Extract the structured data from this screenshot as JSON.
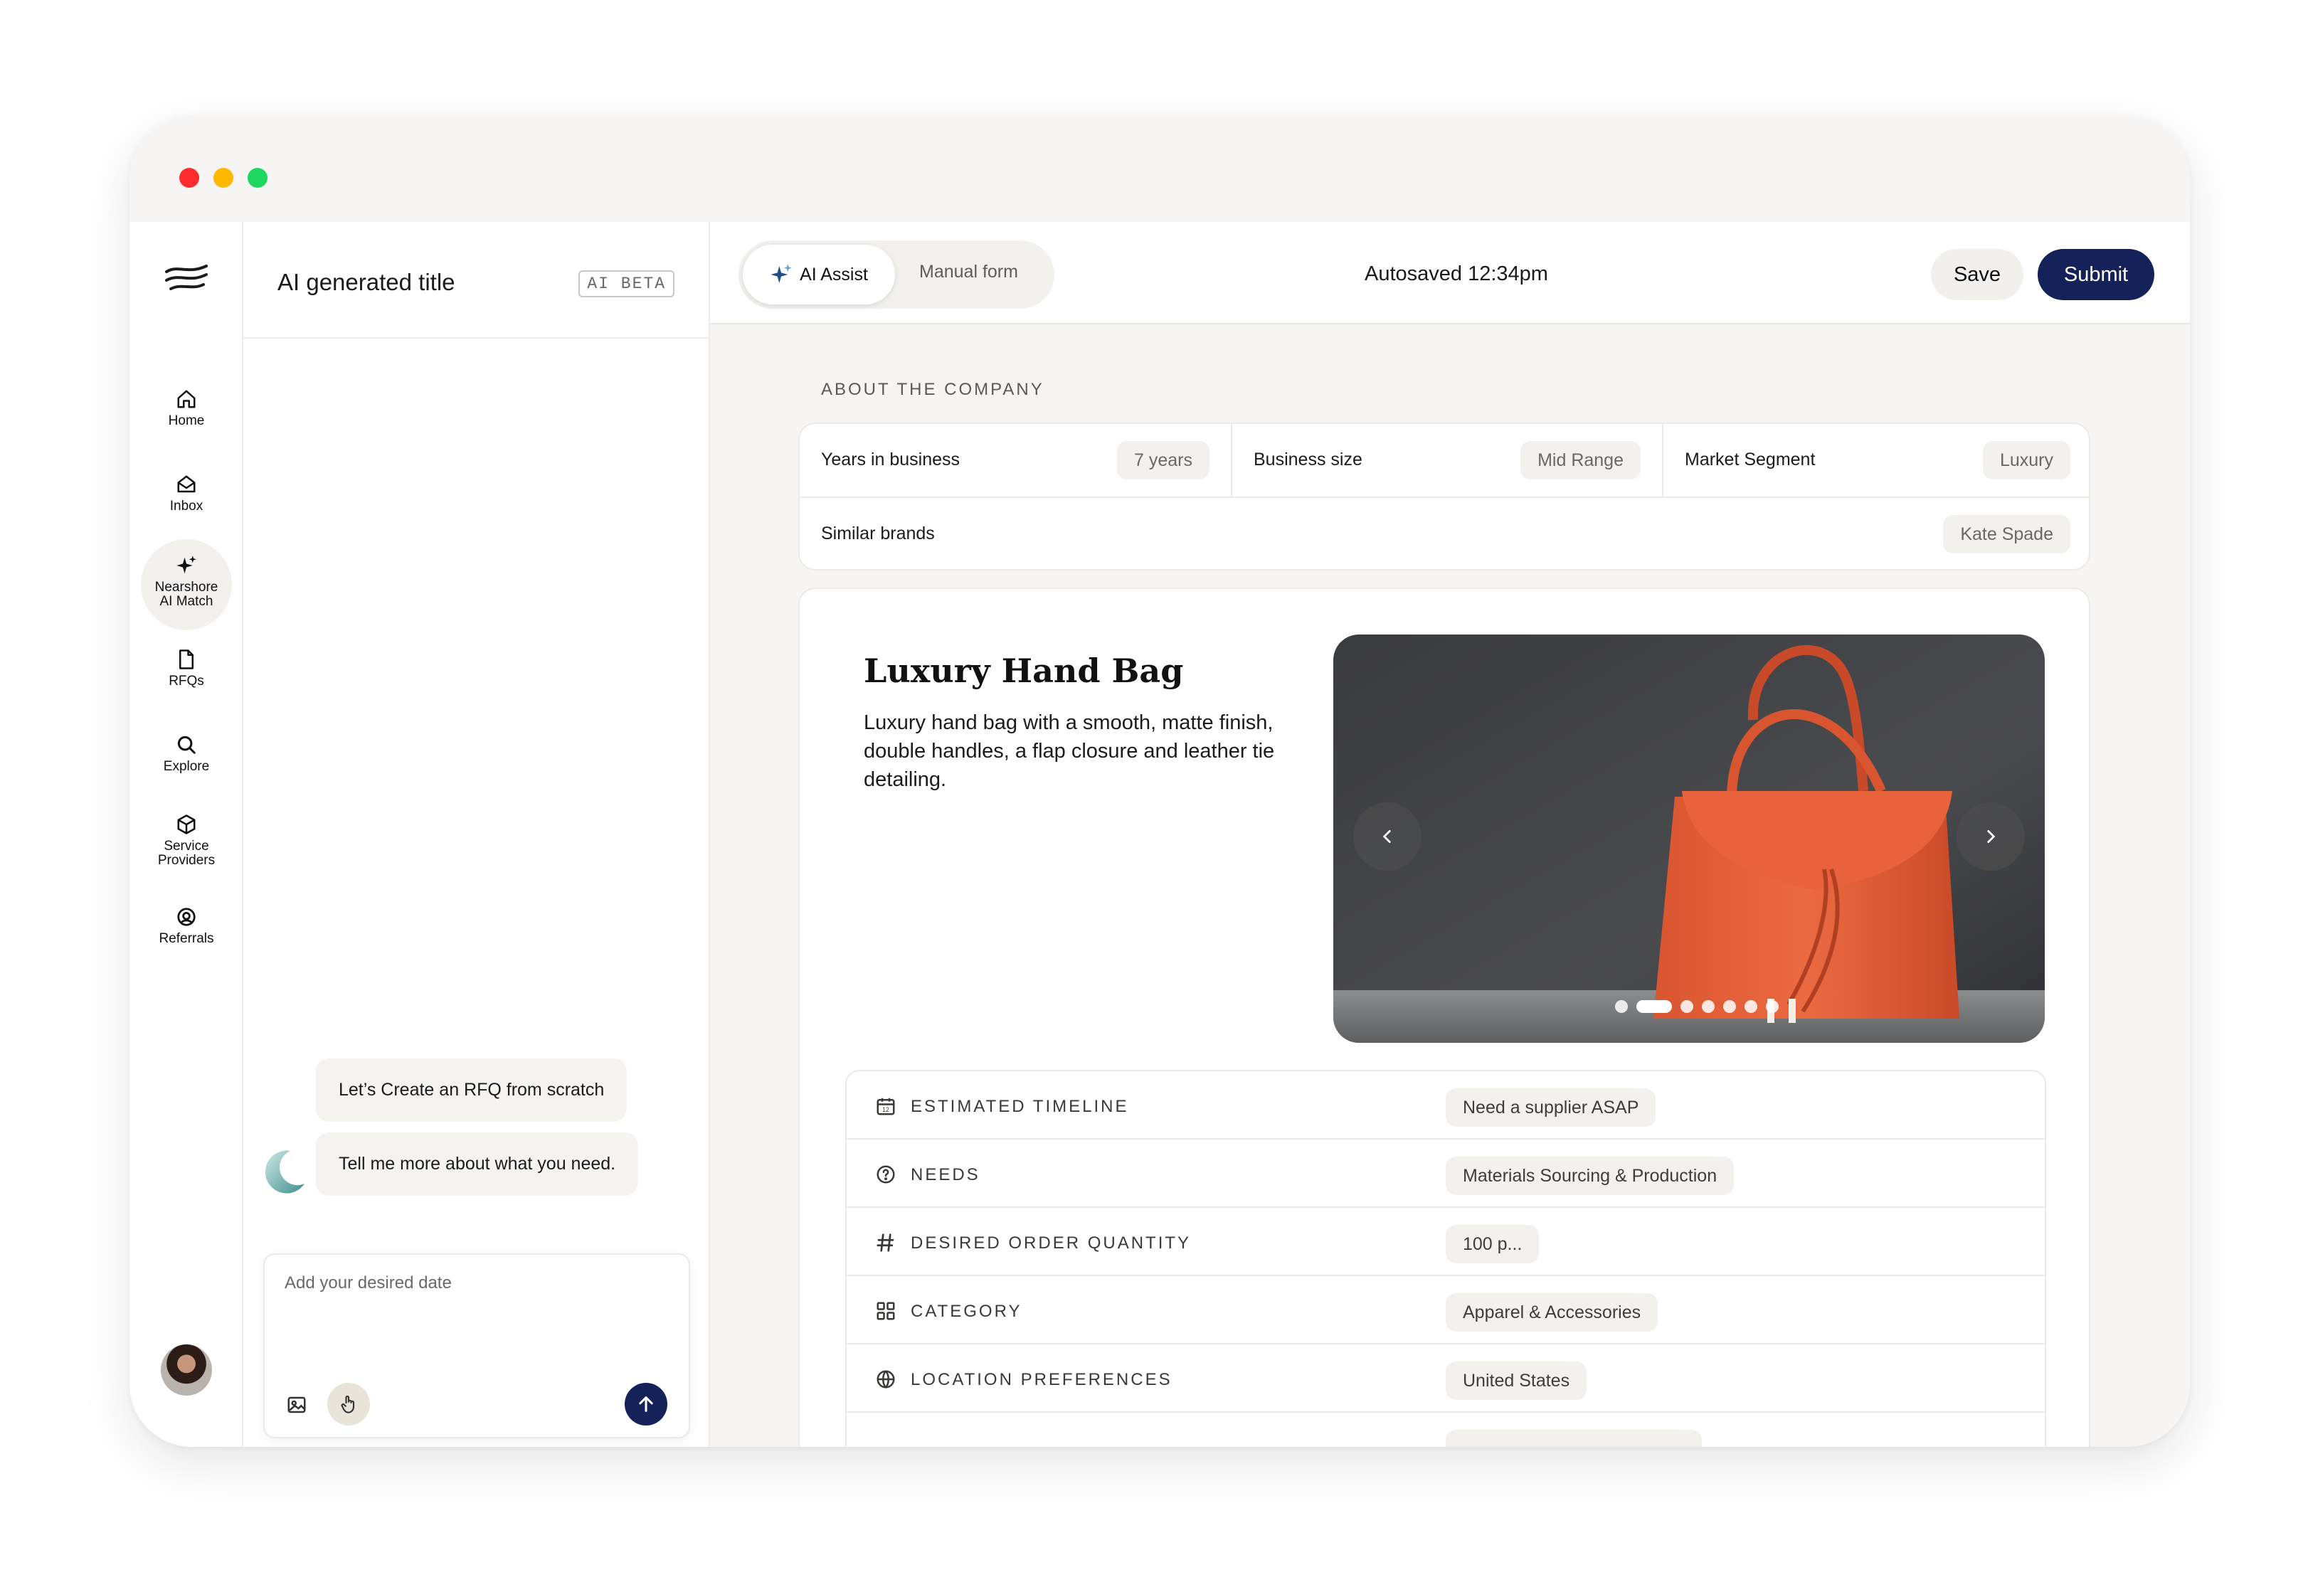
{
  "window": {
    "traffic_lights": {
      "close": "#ff2d2d",
      "minimize": "#ffb800",
      "maximize": "#1ed760"
    }
  },
  "rail": {
    "items": [
      {
        "label": "Home",
        "icon": "home-icon"
      },
      {
        "label": "Inbox",
        "icon": "inbox-icon"
      },
      {
        "label": "Nearshore AI Match",
        "icon": "sparkle-icon",
        "active": true
      },
      {
        "label": "RFQs",
        "icon": "document-icon"
      },
      {
        "label": "Explore",
        "icon": "search-icon"
      },
      {
        "label": "Service Providers",
        "icon": "package-icon"
      },
      {
        "label": "Referrals",
        "icon": "referral-icon"
      }
    ]
  },
  "chat": {
    "title": "AI generated title",
    "badge": "AI BETA",
    "messages": [
      {
        "text": "Let’s Create an RFQ from scratch"
      },
      {
        "text": "Tell me more about what you need."
      }
    ],
    "composer_placeholder": "Add your desired date"
  },
  "topbar": {
    "mode_ai": "AI Assist",
    "mode_manual": "Manual form",
    "autosave": "Autosaved 12:34pm",
    "save": "Save",
    "submit": "Submit"
  },
  "company": {
    "section_label": "ABOUT THE COMPANY",
    "fields": [
      {
        "label": "Years in business",
        "value": "7 years"
      },
      {
        "label": "Business size",
        "value": "Mid Range"
      },
      {
        "label": "Market Segment",
        "value": "Luxury"
      },
      {
        "label": "Similar brands",
        "value": "Kate Spade"
      }
    ]
  },
  "product": {
    "title": "Luxury Hand Bag",
    "description": "Luxury hand bag with a smooth, matte finish, double handles, a flap closure and leather tie detailing.",
    "carousel": {
      "slides": 7,
      "active": 2
    }
  },
  "specs": [
    {
      "label": "ESTIMATED TIMELINE",
      "value": "Need a supplier ASAP",
      "icon": "calendar-icon"
    },
    {
      "label": "NEEDS",
      "value": "Materials Sourcing & Production",
      "icon": "help-circle-icon"
    },
    {
      "label": "DESIRED ORDER QUANTITY",
      "value": "100 p...",
      "icon": "hash-icon"
    },
    {
      "label": "CATEGORY",
      "value": "Apparel & Accessories",
      "icon": "grid-icon"
    },
    {
      "label": "LOCATION PREFERENCES",
      "value": "United States",
      "icon": "globe-icon"
    }
  ],
  "colors": {
    "primary": "#152259",
    "accent_bag": "#e0603c"
  }
}
